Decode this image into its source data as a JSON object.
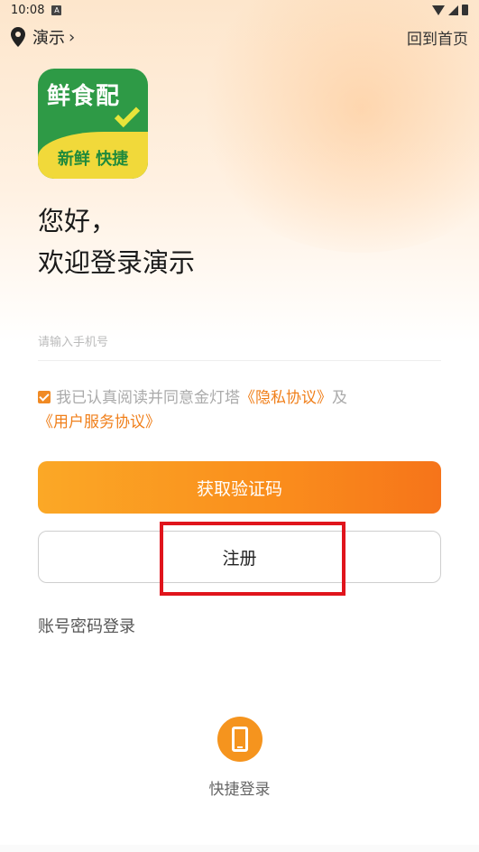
{
  "status_bar": {
    "time": "10:08",
    "badge": "A"
  },
  "top_bar": {
    "location": "演示",
    "home_link": "回到首页"
  },
  "logo": {
    "top_text": "鲜食配",
    "bottom_text": "新鲜 快捷"
  },
  "greeting": {
    "line1": "您好，",
    "line2": "欢迎登录演示"
  },
  "phone_input": {
    "placeholder": "请输入手机号",
    "value": ""
  },
  "agreement": {
    "checked": true,
    "prefix": "我已认真阅读并同意金灯塔",
    "privacy_link": "《隐私协议》",
    "conjunction": "及",
    "service_link": "《用户服务协议》"
  },
  "buttons": {
    "get_code": "获取验证码",
    "register": "注册"
  },
  "password_login": "账号密码登录",
  "quick_login": {
    "label": "快捷登录",
    "icon": "phone-icon"
  },
  "colors": {
    "accent": "#f5941e",
    "link": "#f07f1a",
    "highlight": "#e0141c"
  }
}
